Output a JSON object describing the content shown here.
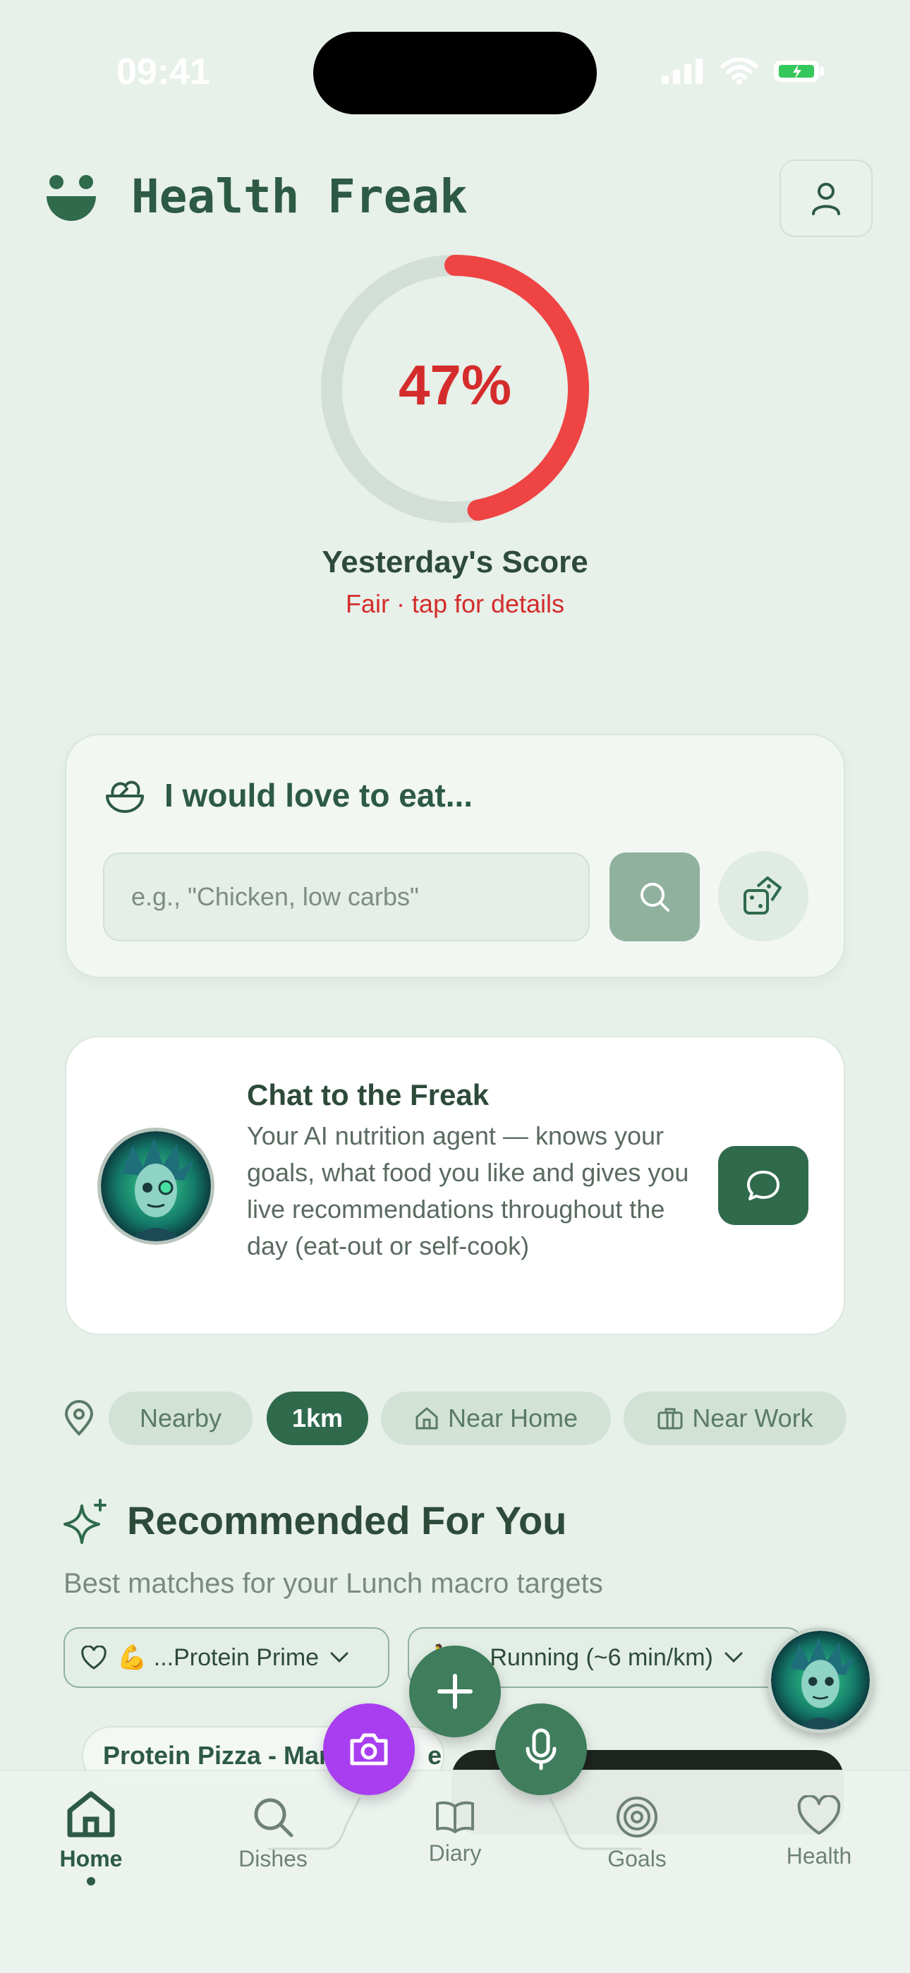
{
  "status_bar": {
    "time": "09:41"
  },
  "header": {
    "title": "Health Freak"
  },
  "score": {
    "value": "47%",
    "fraction": 0.47,
    "label": "Yesterday's Score",
    "sub": "Fair · tap for details",
    "ring_color": "#ef4444",
    "track_color": "#d3ded6"
  },
  "eat": {
    "title": "I would love to eat...",
    "placeholder": "e.g., \"Chicken, low carbs\""
  },
  "chat": {
    "title": "Chat to the Freak",
    "description": "Your AI nutrition agent — knows your goals, what food you like and gives you live recommendations throughout the day (eat-out or self-cook)"
  },
  "filters": {
    "items": [
      {
        "label": "Nearby"
      },
      {
        "label": "1km",
        "active": true
      },
      {
        "label": "Near Home",
        "icon": "house-icon"
      },
      {
        "label": "Near Work",
        "icon": "briefcase-icon"
      }
    ]
  },
  "recommended": {
    "title": "Recommended For You",
    "subtitle": "Best matches for your Lunch macro targets",
    "protein_select": "💪 ...Protein Prime",
    "activity_select": "...Running (~6 min/km)",
    "dish_name": "Protein Pizza - Mar",
    "dish_suffix": "e"
  },
  "nav": {
    "items": [
      {
        "label": "Home",
        "icon": "home-icon",
        "active": true
      },
      {
        "label": "Dishes",
        "icon": "search-icon"
      },
      {
        "label": "Diary",
        "icon": "book-icon"
      },
      {
        "label": "Goals",
        "icon": "target-icon"
      },
      {
        "label": "Health",
        "icon": "heart-icon"
      }
    ]
  },
  "colors": {
    "primary": "#2f6a4d",
    "accent_red": "#d42c2c",
    "camera": "#a83ef0",
    "background": "#e7f0e9"
  }
}
